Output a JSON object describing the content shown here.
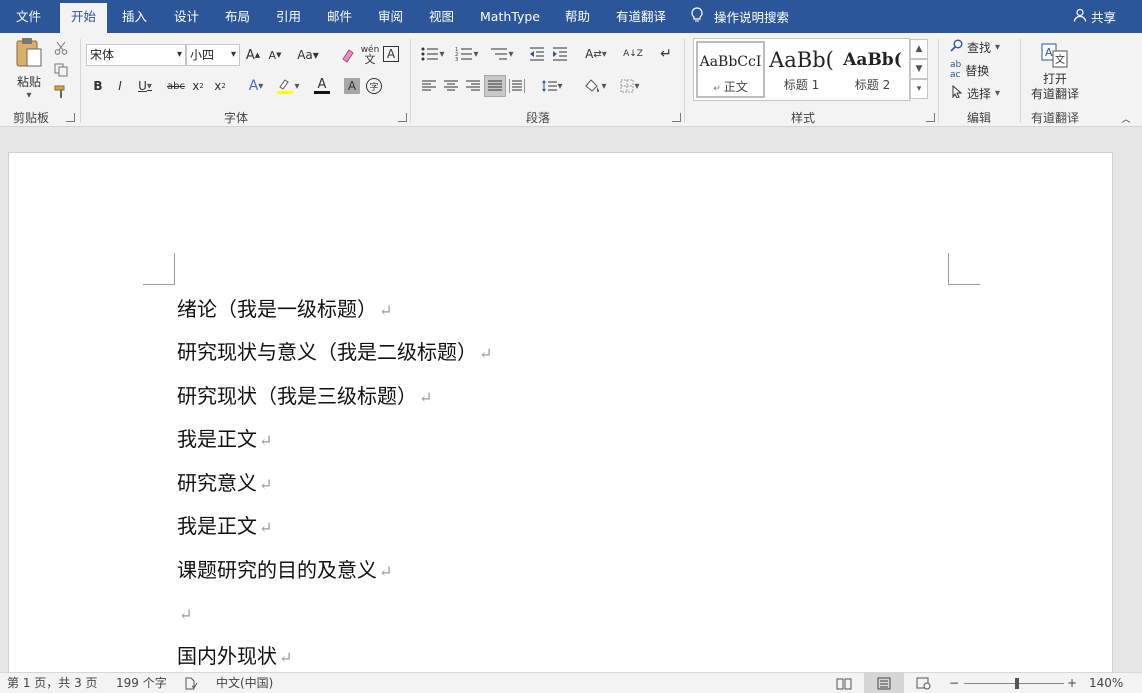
{
  "menubar": {
    "tabs": [
      "文件",
      "开始",
      "插入",
      "设计",
      "布局",
      "引用",
      "邮件",
      "审阅",
      "视图",
      "MathType",
      "帮助",
      "有道翻译"
    ],
    "active_tab": "开始",
    "tell_me": "操作说明搜索",
    "share": "共享"
  },
  "ribbon": {
    "clipboard": {
      "paste": "粘贴",
      "label": "剪贴板"
    },
    "font": {
      "name": "宋体",
      "size": "小四",
      "label": "字体"
    },
    "paragraph": {
      "label": "段落"
    },
    "styles": {
      "label": "样式",
      "items": [
        {
          "preview": "AaBbCcI",
          "name": "正文"
        },
        {
          "preview": "AaBb(",
          "name": "标题 1"
        },
        {
          "preview": "AaBb(",
          "name": "标题 2"
        }
      ]
    },
    "editing": {
      "find": "查找",
      "replace": "替换",
      "select": "选择",
      "label": "编辑"
    },
    "youdao": {
      "open_line1": "打开",
      "open_line2": "有道翻译",
      "label": "有道翻译"
    }
  },
  "document": {
    "paragraphs": [
      "绪论（我是一级标题）",
      "研究现状与意义（我是二级标题）",
      "研究现状（我是三级标题）",
      "我是正文",
      "研究意义",
      "我是正文",
      "课题研究的目的及意义",
      "",
      "国内外现状"
    ],
    "paragraph_mark": "↵"
  },
  "status": {
    "page": "第 1 页，共 3 页",
    "words": "199 个字",
    "language": "中文(中国)",
    "zoom": "140%",
    "zoom_percent": 140
  },
  "colors": {
    "accent": "#2b579a",
    "ribbon_bg": "#f3f3f3"
  }
}
